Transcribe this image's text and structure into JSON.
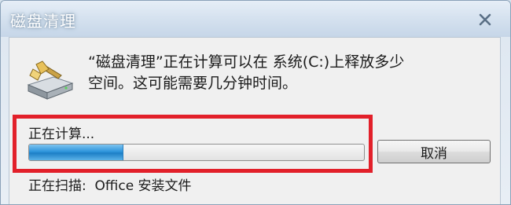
{
  "window": {
    "title": "磁盘清理"
  },
  "message": {
    "line1": "“磁盘清理”正在计算可以在 系统(C:)上释放多少",
    "line2": "空间。这可能需要几分钟时间。"
  },
  "status": {
    "label": "正在计算...",
    "progress_fraction": 0.28,
    "scanning": "正在扫描:  Office 安装文件"
  },
  "buttons": {
    "cancel_label": "取消"
  },
  "icons": {
    "close": "close-icon",
    "disk": "disk-cleanup-icon"
  },
  "colors": {
    "highlight": "#e2202a",
    "progress": "#2e95dc"
  }
}
